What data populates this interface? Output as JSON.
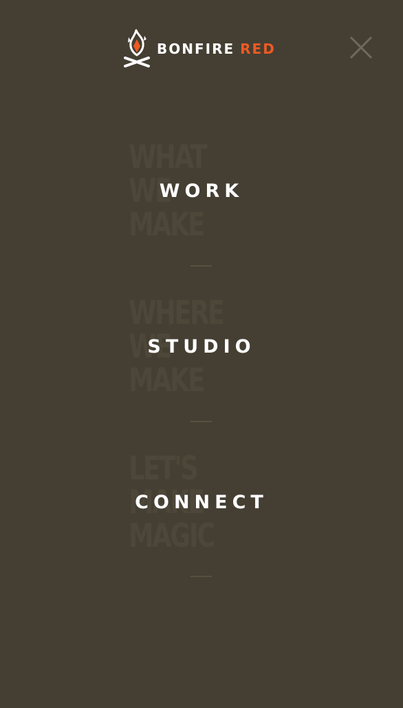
{
  "header": {
    "logo_text_primary": "BONFIRE",
    "logo_text_accent": "RED",
    "logo_alt": "Bonfire Red logo"
  },
  "colors": {
    "background": "#453f33",
    "accent": "#ec5a24",
    "ghost_text": "#4d4739",
    "label": "#ffffff",
    "close_icon": "#6f6a5d"
  },
  "menu": {
    "items": [
      {
        "label": "WORK",
        "ghost_lines": [
          "WHAT",
          "WE",
          "MAKE"
        ]
      },
      {
        "label": "STUDIO",
        "ghost_lines": [
          "WHERE",
          "WE",
          "MAKE"
        ]
      },
      {
        "label": "CONNECT",
        "ghost_lines": [
          "LET'S",
          "MAKE",
          "MAGIC"
        ]
      }
    ]
  },
  "icons": {
    "close": "close-icon",
    "logo": "bonfire-logo-icon"
  }
}
